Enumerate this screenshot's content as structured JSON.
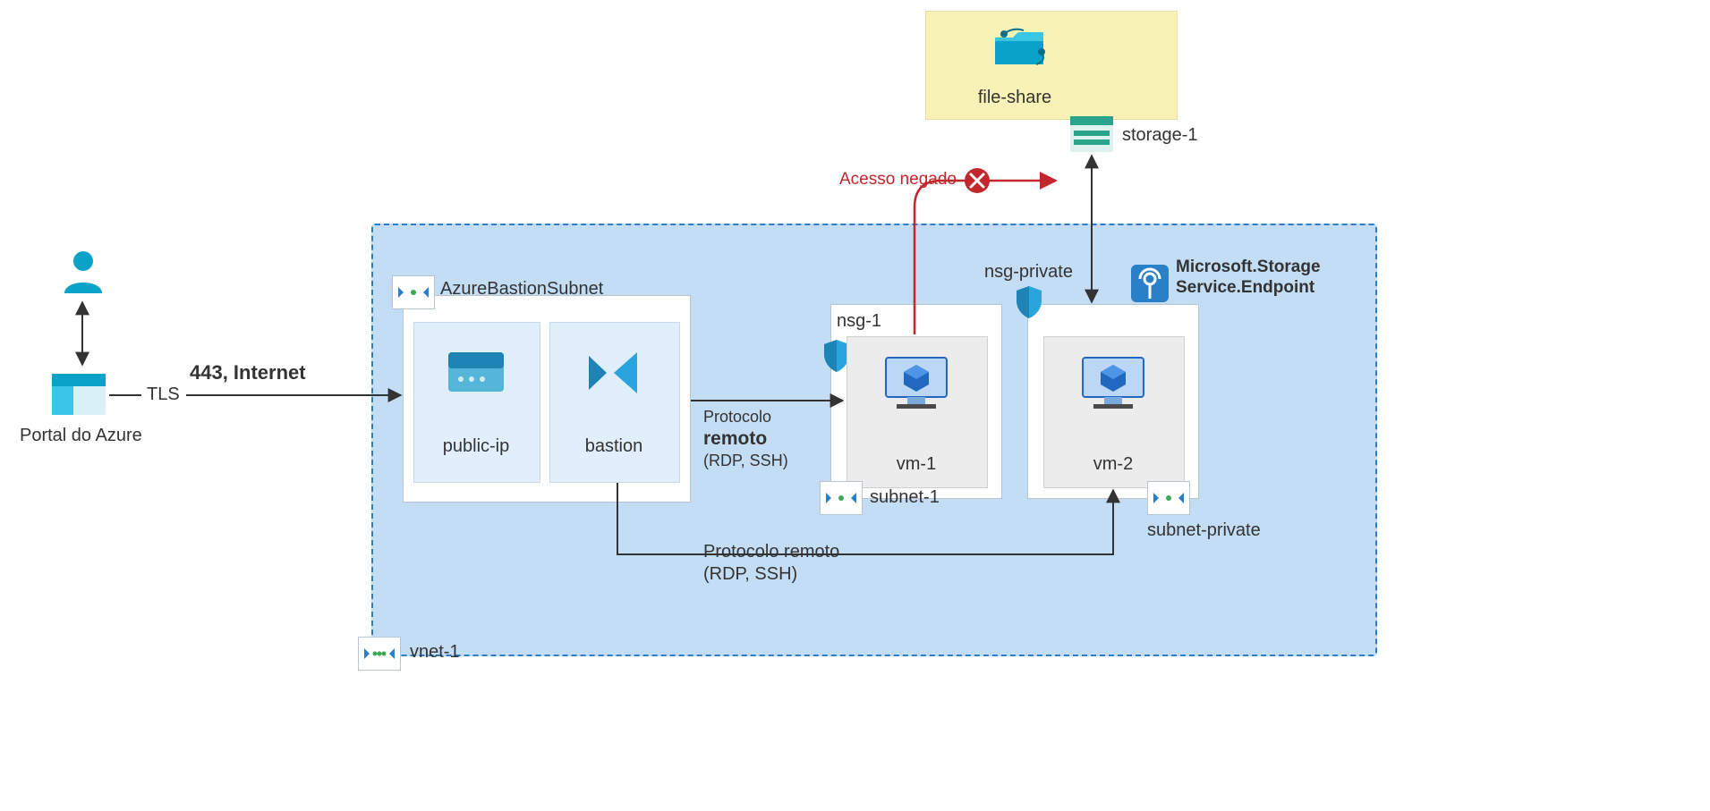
{
  "portal_label": "Portal do Azure",
  "tls_label": "TLS",
  "internet_label": "443, Internet",
  "vnet_label": "vnet-1",
  "bastion_subnet_label": "AzureBastionSubnet",
  "public_ip_label": "public-ip",
  "bastion_label": "bastion",
  "remote_proto_heading": "Protocolo",
  "remote_proto_bold": "remoto",
  "remote_proto_detail": "(RDP, SSH)",
  "remote_proto_line2_a": "Protocolo remoto",
  "remote_proto_line2_b": "(RDP, SSH)",
  "subnet1_label": "subnet-1",
  "nsg1_label": "nsg-1",
  "vm1_label": "vm-1",
  "nsg_private_label": "nsg-private",
  "subnet_private_label": "subnet-private",
  "vm2_label": "vm-2",
  "service_endpoint_line1": "Microsoft.Storage",
  "service_endpoint_line2": "Service.Endpoint",
  "file_share_label": "file-share",
  "storage1_label": "storage-1",
  "access_denied_label": "Acesso negado"
}
